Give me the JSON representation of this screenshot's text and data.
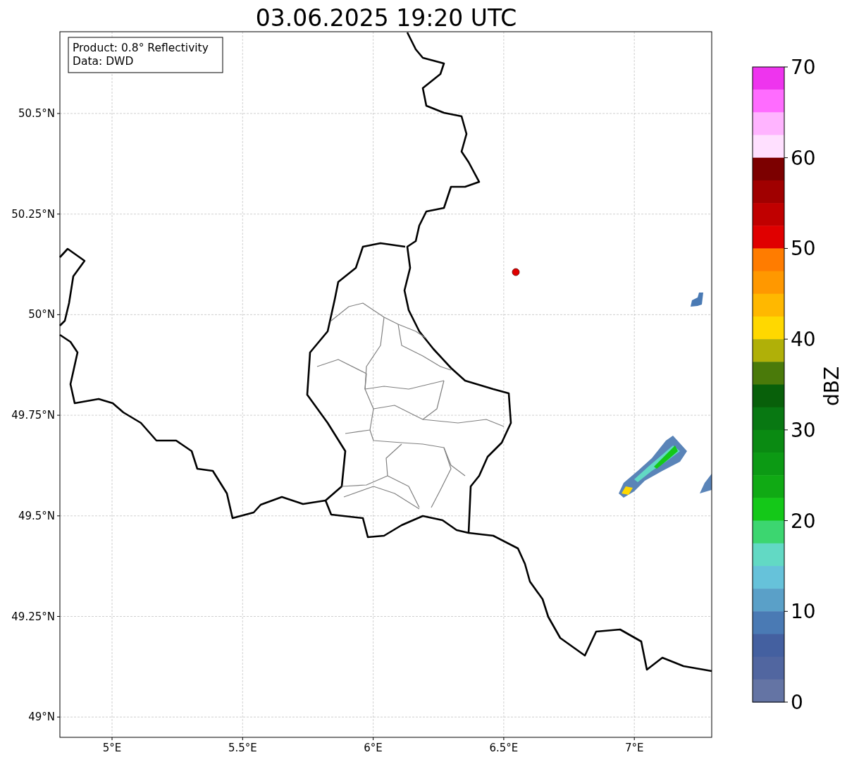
{
  "title": "03.06.2025 19:20 UTC",
  "info_box": [
    "Product: 0.8° Reflectivity",
    "Data: DWD"
  ],
  "map": {
    "x_ticks": [
      "5°E",
      "5.5°E",
      "6°E",
      "6.5°E",
      "7°E"
    ],
    "y_ticks": [
      "50.5°N",
      "50.25°N",
      "50°N",
      "49.75°N",
      "49.5°N",
      "49.25°N",
      "49°N"
    ]
  },
  "colorbar": {
    "label": "dBZ",
    "ticks": [
      "70",
      "60",
      "50",
      "40",
      "30",
      "20",
      "10",
      "0"
    ],
    "bins": [
      {
        "color": "#ee34ee"
      },
      {
        "color": "#ff6cff"
      },
      {
        "color": "#ffb4ff"
      },
      {
        "color": "#ffe0ff"
      },
      {
        "color": "#7c0000"
      },
      {
        "color": "#a00000"
      },
      {
        "color": "#c00000"
      },
      {
        "color": "#e00000"
      },
      {
        "color": "#ff7c00"
      },
      {
        "color": "#ff9800"
      },
      {
        "color": "#ffb800"
      },
      {
        "color": "#ffd800"
      },
      {
        "color": "#b0b008"
      },
      {
        "color": "#4a7a0a"
      },
      {
        "color": "#08600a"
      },
      {
        "color": "#087812"
      },
      {
        "color": "#0a8a12"
      },
      {
        "color": "#0c9a14"
      },
      {
        "color": "#10aa14"
      },
      {
        "color": "#14c818"
      },
      {
        "color": "#3cd670"
      },
      {
        "color": "#62d9c4"
      },
      {
        "color": "#66c2da"
      },
      {
        "color": "#5aa0c8"
      },
      {
        "color": "#4a7ab4"
      },
      {
        "color": "#4460a0"
      },
      {
        "color": "#5166a0"
      },
      {
        "color": "#6474a4"
      }
    ]
  }
}
